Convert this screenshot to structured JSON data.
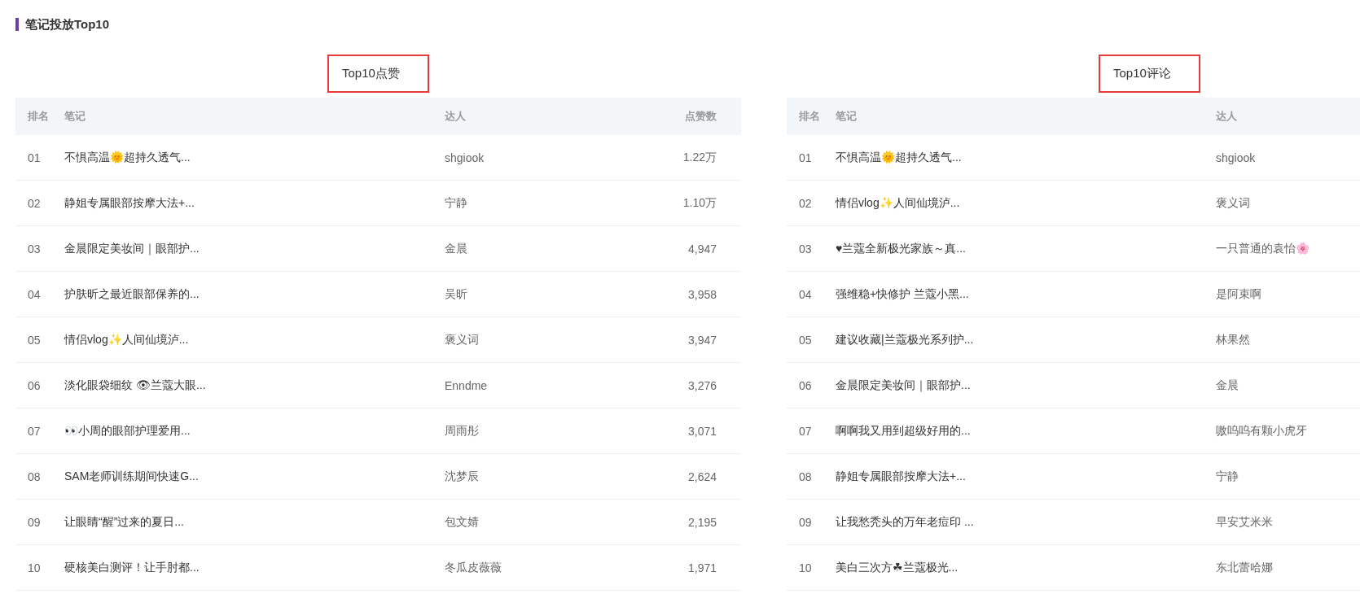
{
  "section_title": "笔记投放Top10",
  "panels": [
    {
      "heading": "Top10点赞",
      "columns": [
        "排名",
        "笔记",
        "达人",
        "点赞数"
      ],
      "rows": [
        {
          "rank": "01",
          "note": "不惧高温🌞超持久透气...",
          "author": "shgiook",
          "count": "1.22万"
        },
        {
          "rank": "02",
          "note": "静姐专属眼部按摩大法+...",
          "author": "宁静",
          "count": "1.10万"
        },
        {
          "rank": "03",
          "note": "金晨限定美妆间｜眼部护...",
          "author": "金晨",
          "count": "4,947"
        },
        {
          "rank": "04",
          "note": "护肤昕之最近眼部保养的...",
          "author": "吴昕",
          "count": "3,958"
        },
        {
          "rank": "05",
          "note": "情侣vlog✨人间仙境泸...",
          "author": "褒义词",
          "count": "3,947"
        },
        {
          "rank": "06",
          "note": "淡化眼袋细纹 👁兰蔻大眼...",
          "author": "Enndme",
          "count": "3,276"
        },
        {
          "rank": "07",
          "note": "👀小周的眼部护理爱用...",
          "author": "周雨彤",
          "count": "3,071"
        },
        {
          "rank": "08",
          "note": "SAM老师训练期间快速G...",
          "author": "沈梦辰",
          "count": "2,624"
        },
        {
          "rank": "09",
          "note": "让眼睛“醒”过来的夏日...",
          "author": "包文婧",
          "count": "2,195"
        },
        {
          "rank": "10",
          "note": "硬核美白测评！让手肘都...",
          "author": "冬瓜皮薇薇",
          "count": "1,971"
        }
      ]
    },
    {
      "heading": "Top10评论",
      "columns": [
        "排名",
        "笔记",
        "达人"
      ],
      "rows": [
        {
          "rank": "01",
          "note": "不惧高温🌞超持久透气...",
          "author": "shgiook"
        },
        {
          "rank": "02",
          "note": "情侣vlog✨人间仙境泸...",
          "author": "褒义词"
        },
        {
          "rank": "03",
          "note": "♥兰蔻全新极光家族～真...",
          "author": "一只普通的袁怡🌸"
        },
        {
          "rank": "04",
          "note": "强维稳+快修护 兰蔻小黑...",
          "author": "是阿束啊"
        },
        {
          "rank": "05",
          "note": "建议收藏|兰蔻极光系列护...",
          "author": "林果然"
        },
        {
          "rank": "06",
          "note": "金晨限定美妆间｜眼部护...",
          "author": "金晨"
        },
        {
          "rank": "07",
          "note": "啊啊我又用到超级好用的...",
          "author": "嗷呜呜有颗小虎牙"
        },
        {
          "rank": "08",
          "note": "静姐专属眼部按摩大法+...",
          "author": "宁静"
        },
        {
          "rank": "09",
          "note": "让我愁秃头的万年老痘印 ...",
          "author": "早安艾米米"
        },
        {
          "rank": "10",
          "note": "美白三次方☘兰蔻极光...",
          "author": "东北蕾哈娜"
        }
      ]
    }
  ]
}
